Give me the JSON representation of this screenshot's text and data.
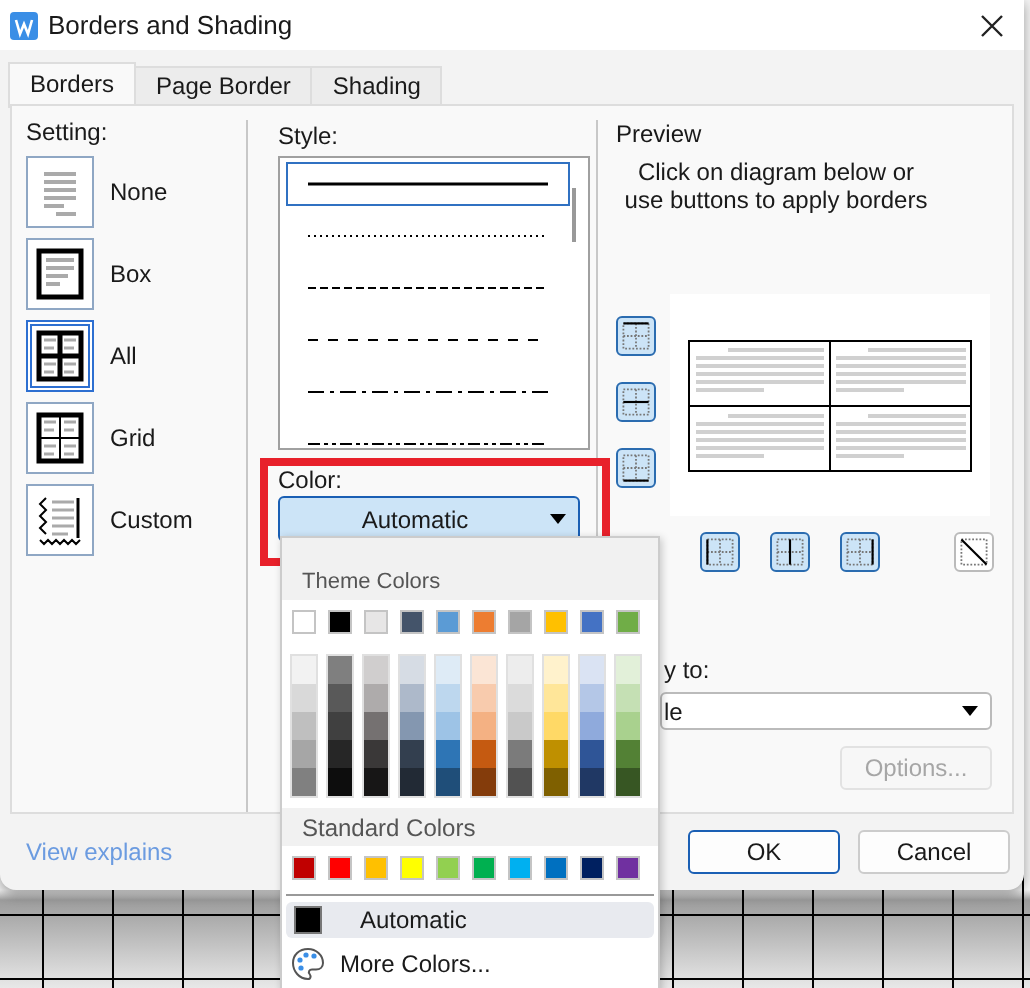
{
  "window": {
    "title": "Borders and Shading"
  },
  "tabs": [
    {
      "label": "Borders",
      "selected": true
    },
    {
      "label": "Page Border",
      "selected": false
    },
    {
      "label": "Shading",
      "selected": false
    }
  ],
  "setting": {
    "label": "Setting:",
    "items": [
      {
        "kind": "none",
        "label": "None",
        "selected": false
      },
      {
        "kind": "box",
        "label": "Box",
        "selected": false
      },
      {
        "kind": "all",
        "label": "All",
        "selected": true
      },
      {
        "kind": "grid",
        "label": "Grid",
        "selected": false
      },
      {
        "kind": "custom",
        "label": "Custom",
        "selected": false
      }
    ]
  },
  "style": {
    "label": "Style:",
    "items": [
      {
        "kind": "solid",
        "selected": true
      },
      {
        "kind": "dotted",
        "selected": false
      },
      {
        "kind": "dashed",
        "selected": false
      },
      {
        "kind": "dash-small",
        "selected": false
      },
      {
        "kind": "dash-dot",
        "selected": false
      },
      {
        "kind": "dash-dot-dot",
        "selected": false
      }
    ]
  },
  "color": {
    "label": "Color:",
    "value": "Automatic"
  },
  "color_menu": {
    "theme_label": "Theme Colors",
    "theme": [
      {
        "color": "#ffffff"
      },
      {
        "color": "#000000"
      },
      {
        "color": "#e7e6e6"
      },
      {
        "color": "#44546a"
      },
      {
        "color": "#5b9bd5"
      },
      {
        "color": "#ed7d31"
      },
      {
        "color": "#a5a5a5"
      },
      {
        "color": "#ffc000"
      },
      {
        "color": "#4472c4"
      },
      {
        "color": "#70ad47"
      }
    ],
    "shades": [
      [
        {
          "color": "#f2f2f2"
        },
        {
          "color": "#d9d9d9"
        },
        {
          "color": "#bfbfbf"
        },
        {
          "color": "#a6a6a6"
        },
        {
          "color": "#808080"
        }
      ],
      [
        {
          "color": "#7f7f7f"
        },
        {
          "color": "#595959"
        },
        {
          "color": "#404040"
        },
        {
          "color": "#262626"
        },
        {
          "color": "#0d0d0d"
        }
      ],
      [
        {
          "color": "#d0cece"
        },
        {
          "color": "#aeabab"
        },
        {
          "color": "#757171"
        },
        {
          "color": "#3a3838"
        },
        {
          "color": "#171616"
        }
      ],
      [
        {
          "color": "#d6dce4"
        },
        {
          "color": "#adb9ca"
        },
        {
          "color": "#8497b0"
        },
        {
          "color": "#333f4f"
        },
        {
          "color": "#222a35"
        }
      ],
      [
        {
          "color": "#deebf6"
        },
        {
          "color": "#bdd7ee"
        },
        {
          "color": "#9dc3e6"
        },
        {
          "color": "#2e75b5"
        },
        {
          "color": "#1f4e79"
        }
      ],
      [
        {
          "color": "#fbe5d5"
        },
        {
          "color": "#f8cbad"
        },
        {
          "color": "#f4b183"
        },
        {
          "color": "#c55a11"
        },
        {
          "color": "#843c0b"
        }
      ],
      [
        {
          "color": "#ededed"
        },
        {
          "color": "#dbdbdb"
        },
        {
          "color": "#c9c9c9"
        },
        {
          "color": "#7b7b7b"
        },
        {
          "color": "#525252"
        }
      ],
      [
        {
          "color": "#fff2cc"
        },
        {
          "color": "#ffe699"
        },
        {
          "color": "#ffd966"
        },
        {
          "color": "#bf9000"
        },
        {
          "color": "#7f6000"
        }
      ],
      [
        {
          "color": "#dae3f3"
        },
        {
          "color": "#b4c7e7"
        },
        {
          "color": "#8faadc"
        },
        {
          "color": "#2f5597"
        },
        {
          "color": "#203864"
        }
      ],
      [
        {
          "color": "#e2f0d9"
        },
        {
          "color": "#c5e0b4"
        },
        {
          "color": "#a9d18e"
        },
        {
          "color": "#538135"
        },
        {
          "color": "#375623"
        }
      ]
    ],
    "standard_label": "Standard Colors",
    "standard": [
      {
        "color": "#c00000"
      },
      {
        "color": "#ff0000"
      },
      {
        "color": "#ffc000"
      },
      {
        "color": "#ffff00"
      },
      {
        "color": "#92d050"
      },
      {
        "color": "#00b050"
      },
      {
        "color": "#00b0f0"
      },
      {
        "color": "#0070c0"
      },
      {
        "color": "#002060"
      },
      {
        "color": "#7030a0"
      }
    ],
    "automatic": {
      "label": "Automatic",
      "color": "#000000",
      "selected": true
    },
    "more": "More Colors..."
  },
  "preview": {
    "label": "Preview",
    "hint": "Click on diagram below or use buttons to apply borders",
    "side_buttons": [
      {
        "kind": "top",
        "on": true
      },
      {
        "kind": "middle",
        "on": true
      },
      {
        "kind": "bottom",
        "on": true
      }
    ],
    "bottom_buttons": [
      {
        "kind": "left",
        "on": true
      },
      {
        "kind": "center",
        "on": true
      },
      {
        "kind": "right",
        "on": true
      },
      {
        "kind": "diagonal",
        "on": false
      }
    ]
  },
  "apply_to": {
    "label": "y to:",
    "value": "le"
  },
  "options_button": {
    "label": "Options...",
    "disabled": true
  },
  "link": "View explains",
  "buttons": [
    {
      "label": "OK",
      "default": true
    },
    {
      "label": "Cancel",
      "default": false
    }
  ]
}
